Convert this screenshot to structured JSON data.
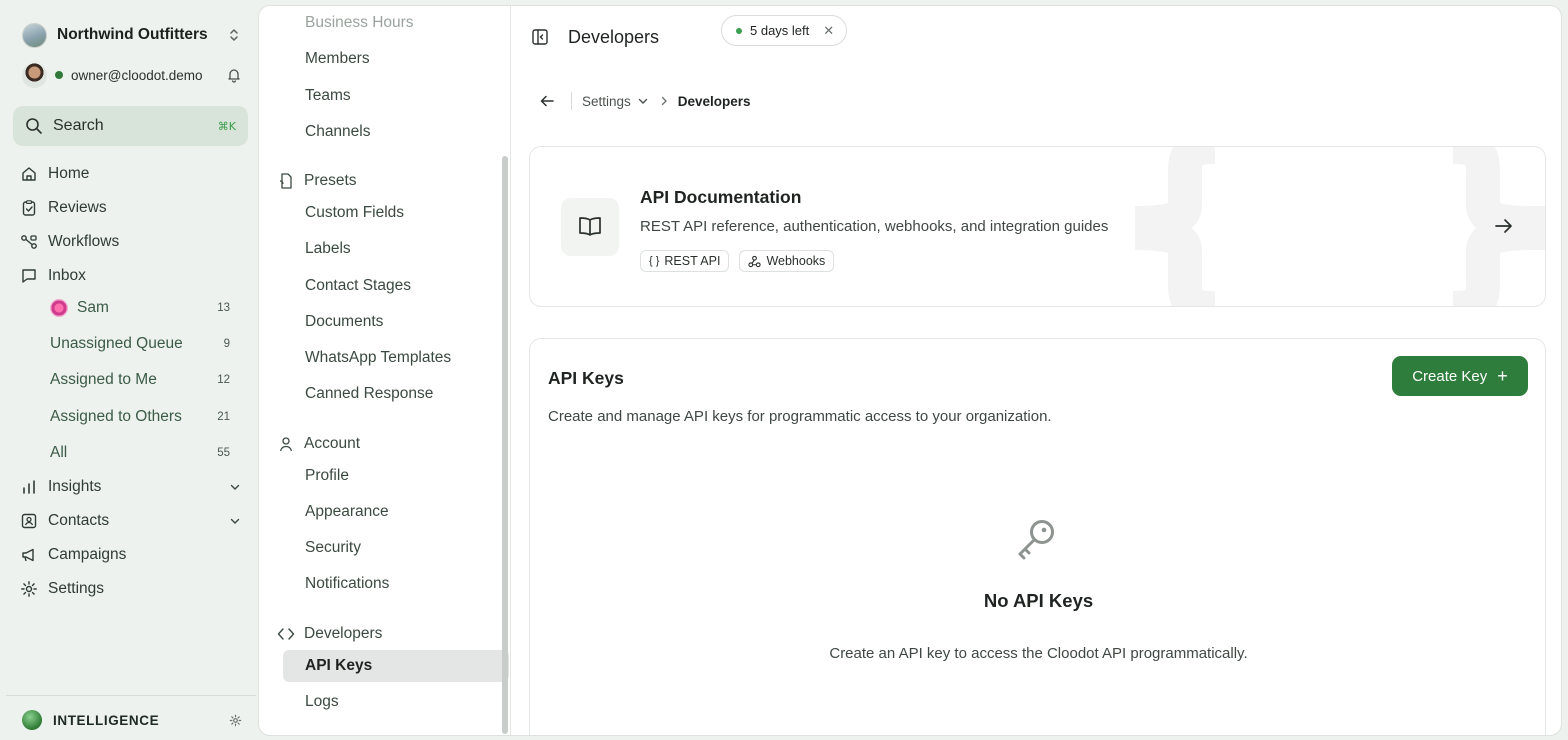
{
  "workspace": {
    "name": "Northwind Outfitters"
  },
  "user": {
    "email": "owner@cloodot.demo"
  },
  "search": {
    "label": "Search",
    "shortcut": "⌘K"
  },
  "nav": {
    "home": "Home",
    "reviews": "Reviews",
    "workflows": "Workflows",
    "inbox": "Inbox",
    "inbox_items": [
      {
        "label": "Sam",
        "count": "13"
      },
      {
        "label": "Unassigned Queue",
        "count": "9"
      },
      {
        "label": "Assigned to Me",
        "count": "12"
      },
      {
        "label": "Assigned to Others",
        "count": "21"
      },
      {
        "label": "All",
        "count": "55"
      }
    ],
    "insights": "Insights",
    "contacts": "Contacts",
    "campaigns": "Campaigns",
    "settings": "Settings"
  },
  "intelligence": {
    "label": "INTELLIGENCE"
  },
  "settings_nav": {
    "business_hours": "Business Hours",
    "members": "Members",
    "teams": "Teams",
    "channels": "Channels",
    "presets": "Presets",
    "presets_items": [
      "Custom Fields",
      "Labels",
      "Contact Stages",
      "Documents",
      "WhatsApp Templates",
      "Canned Response"
    ],
    "account": "Account",
    "account_items": [
      "Profile",
      "Appearance",
      "Security",
      "Notifications"
    ],
    "developers": "Developers",
    "developers_items": [
      "API Keys",
      "Logs"
    ]
  },
  "header": {
    "title": "Developers",
    "trial": "5 days left"
  },
  "breadcrumb": {
    "parent": "Settings",
    "current": "Developers"
  },
  "api_docs": {
    "title": "API Documentation",
    "description": "REST API reference, authentication, webhooks, and integration guides",
    "tags": [
      "REST API",
      "Webhooks"
    ]
  },
  "api_keys": {
    "title": "API Keys",
    "description": "Create and manage API keys for programmatic access to your organization.",
    "create_label": "Create Key",
    "empty_title": "No API Keys",
    "empty_description": "Create an API key to access the Cloodot API programmatically."
  },
  "colors": {
    "accent": "#2f7d3c",
    "sidebar_bg": "#eef2ee",
    "active_item": "#e3e6e4"
  }
}
